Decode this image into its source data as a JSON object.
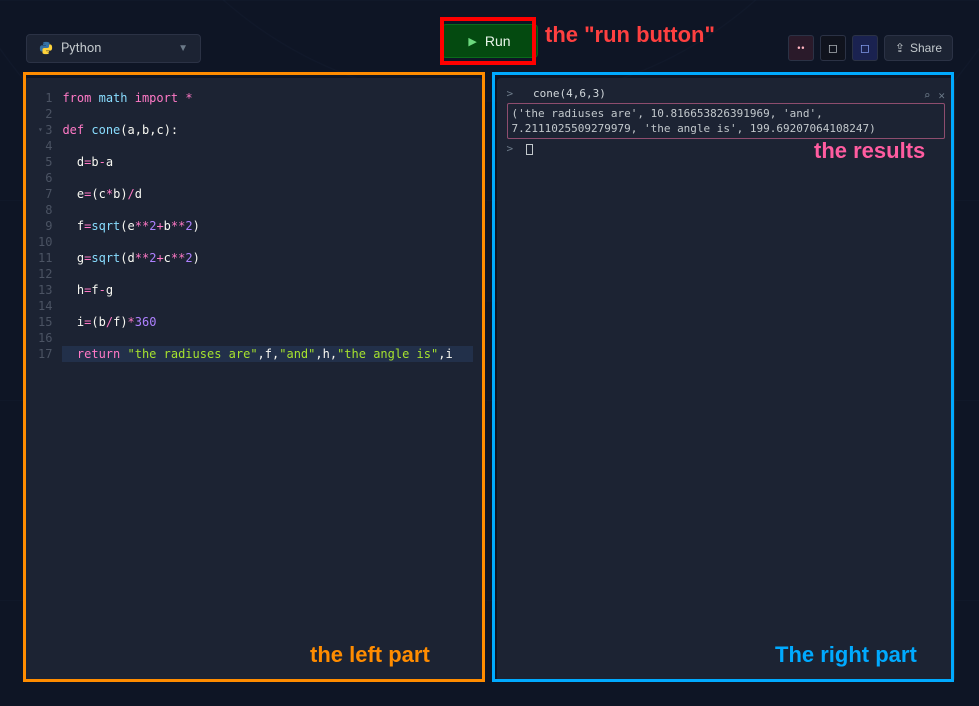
{
  "toolbar": {
    "language": "Python",
    "run_label": "Run",
    "share_label": "Share"
  },
  "annotations": {
    "run_button": "the \"run button\"",
    "left_part": "the left part",
    "right_part": "The right part",
    "results": "the results"
  },
  "editor": {
    "lines": [
      {
        "n": 1,
        "raw": "from math import *"
      },
      {
        "n": 2,
        "raw": ""
      },
      {
        "n": 3,
        "raw": "def cone(a,b,c):",
        "fold": true
      },
      {
        "n": 4,
        "raw": ""
      },
      {
        "n": 5,
        "raw": "  d=b-a"
      },
      {
        "n": 6,
        "raw": ""
      },
      {
        "n": 7,
        "raw": "  e=(c*b)/d"
      },
      {
        "n": 8,
        "raw": ""
      },
      {
        "n": 9,
        "raw": "  f=sqrt(e**2+b**2)"
      },
      {
        "n": 10,
        "raw": ""
      },
      {
        "n": 11,
        "raw": "  g=sqrt(d**2+c**2)"
      },
      {
        "n": 12,
        "raw": ""
      },
      {
        "n": 13,
        "raw": "  h=f-g"
      },
      {
        "n": 14,
        "raw": ""
      },
      {
        "n": 15,
        "raw": "  i=(b/f)*360"
      },
      {
        "n": 16,
        "raw": ""
      },
      {
        "n": 17,
        "raw": "  return \"the radiuses are\",f,\"and\",h,\"the angle is\",i",
        "hl": true
      }
    ]
  },
  "console": {
    "input_cmd": "cone(4,6,3)",
    "output": "('the radiuses are', 10.816653826391969, 'and', 7.2111025509279979, 'the angle is', 199.69207064108247)",
    "prompt": ">"
  }
}
